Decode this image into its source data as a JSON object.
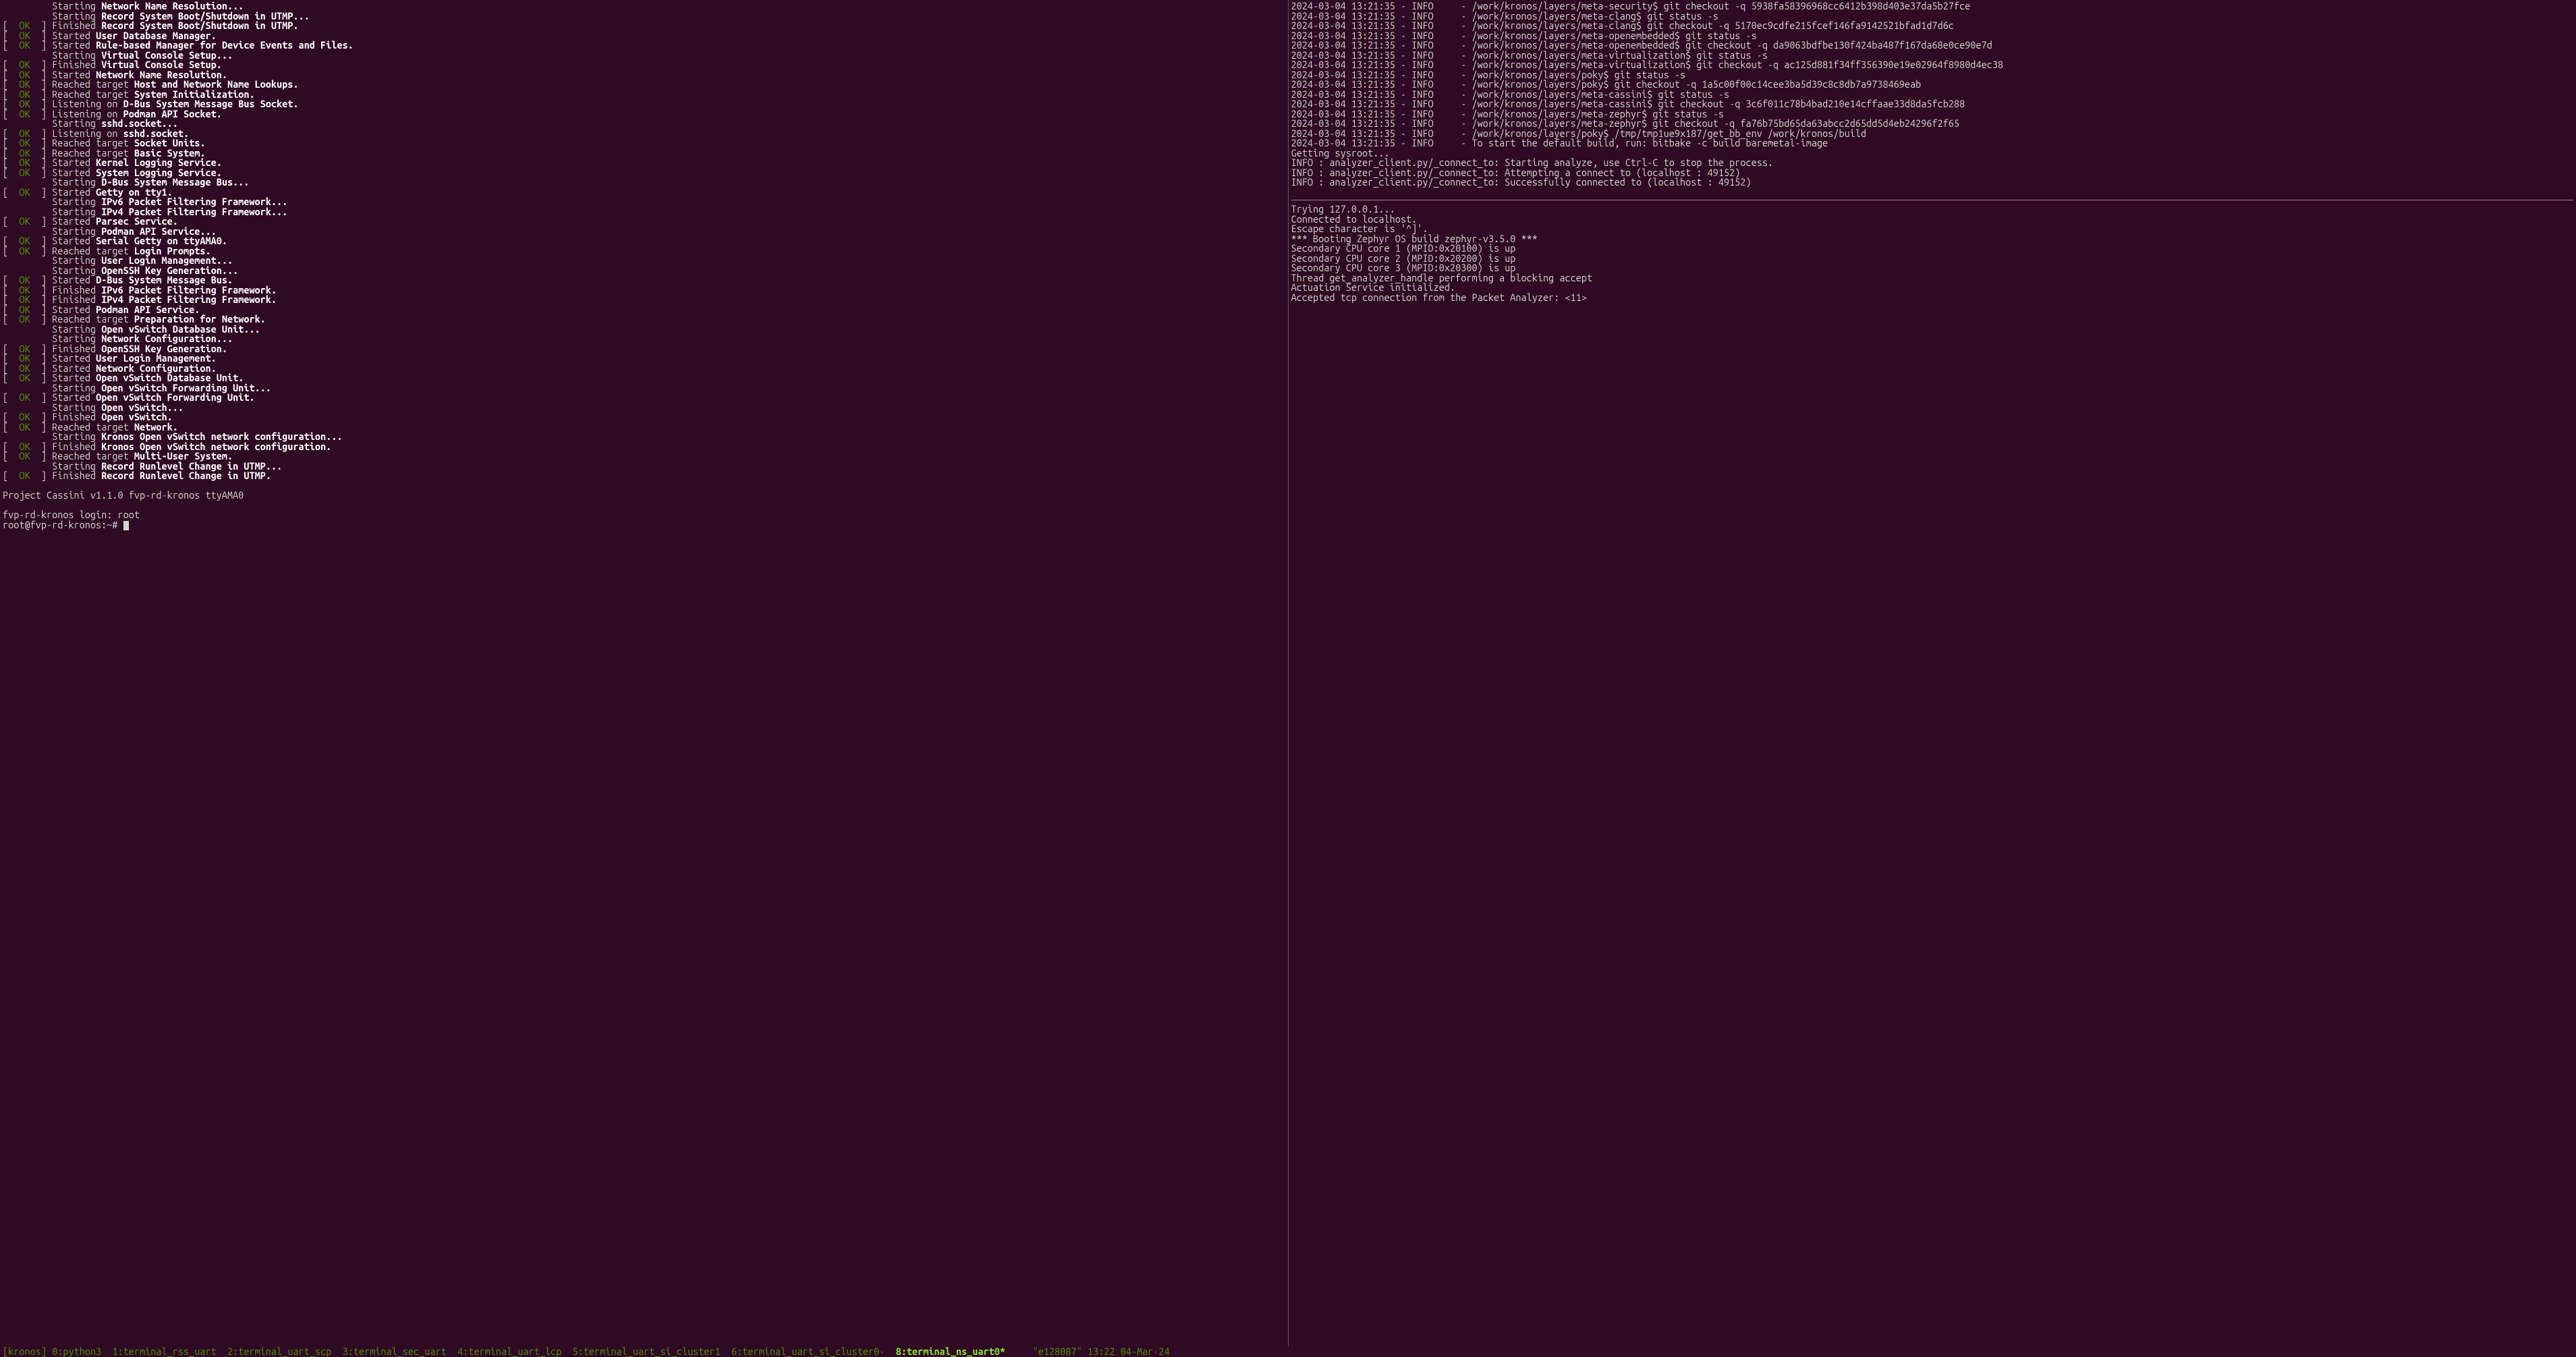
{
  "left": {
    "lines": [
      {
        "kind": "action",
        "verb": "Starting",
        "msg": "Network Name Resolution..."
      },
      {
        "kind": "action",
        "verb": "Starting",
        "msg": "Record System Boot/Shutdown in UTMP..."
      },
      {
        "kind": "ok",
        "verb": "Finished",
        "msg": "Record System Boot/Shutdown in UTMP."
      },
      {
        "kind": "ok",
        "verb": "Started",
        "msg": "User Database Manager."
      },
      {
        "kind": "ok",
        "verb": "Started",
        "msg": "Rule-based Manager for Device Events and Files."
      },
      {
        "kind": "action",
        "verb": "Starting",
        "msg": "Virtual Console Setup..."
      },
      {
        "kind": "ok",
        "verb": "Finished",
        "msg": "Virtual Console Setup."
      },
      {
        "kind": "ok",
        "verb": "Started",
        "msg": "Network Name Resolution."
      },
      {
        "kind": "ok",
        "verb": "Reached target",
        "msg": "Host and Network Name Lookups."
      },
      {
        "kind": "ok",
        "verb": "Reached target",
        "msg": "System Initialization."
      },
      {
        "kind": "ok",
        "verb": "Listening on",
        "msg": "D-Bus System Message Bus Socket."
      },
      {
        "kind": "ok",
        "verb": "Listening on",
        "msg": "Podman API Socket."
      },
      {
        "kind": "action",
        "verb": "Starting",
        "msg": "sshd.socket..."
      },
      {
        "kind": "ok",
        "verb": "Listening on",
        "msg": "sshd.socket."
      },
      {
        "kind": "ok",
        "verb": "Reached target",
        "msg": "Socket Units."
      },
      {
        "kind": "ok",
        "verb": "Reached target",
        "msg": "Basic System."
      },
      {
        "kind": "ok",
        "verb": "Started",
        "msg": "Kernel Logging Service."
      },
      {
        "kind": "ok",
        "verb": "Started",
        "msg": "System Logging Service."
      },
      {
        "kind": "action",
        "verb": "Starting",
        "msg": "D-Bus System Message Bus..."
      },
      {
        "kind": "ok",
        "verb": "Started",
        "msg": "Getty on tty1."
      },
      {
        "kind": "action",
        "verb": "Starting",
        "msg": "IPv6 Packet Filtering Framework..."
      },
      {
        "kind": "action",
        "verb": "Starting",
        "msg": "IPv4 Packet Filtering Framework..."
      },
      {
        "kind": "ok",
        "verb": "Started",
        "msg": "Parsec Service."
      },
      {
        "kind": "action",
        "verb": "Starting",
        "msg": "Podman API Service..."
      },
      {
        "kind": "ok",
        "verb": "Started",
        "msg": "Serial Getty on ttyAMA0."
      },
      {
        "kind": "ok",
        "verb": "Reached target",
        "msg": "Login Prompts."
      },
      {
        "kind": "action",
        "verb": "Starting",
        "msg": "User Login Management..."
      },
      {
        "kind": "action",
        "verb": "Starting",
        "msg": "OpenSSH Key Generation..."
      },
      {
        "kind": "ok",
        "verb": "Started",
        "msg": "D-Bus System Message Bus."
      },
      {
        "kind": "ok",
        "verb": "Finished",
        "msg": "IPv6 Packet Filtering Framework."
      },
      {
        "kind": "ok",
        "verb": "Finished",
        "msg": "IPv4 Packet Filtering Framework."
      },
      {
        "kind": "ok",
        "verb": "Started",
        "msg": "Podman API Service."
      },
      {
        "kind": "ok",
        "verb": "Reached target",
        "msg": "Preparation for Network."
      },
      {
        "kind": "action",
        "verb": "Starting",
        "msg": "Open vSwitch Database Unit..."
      },
      {
        "kind": "action",
        "verb": "Starting",
        "msg": "Network Configuration..."
      },
      {
        "kind": "ok",
        "verb": "Finished",
        "msg": "OpenSSH Key Generation."
      },
      {
        "kind": "ok",
        "verb": "Started",
        "msg": "User Login Management."
      },
      {
        "kind": "ok",
        "verb": "Started",
        "msg": "Network Configuration."
      },
      {
        "kind": "ok",
        "verb": "Started",
        "msg": "Open vSwitch Database Unit."
      },
      {
        "kind": "action",
        "verb": "Starting",
        "msg": "Open vSwitch Forwarding Unit..."
      },
      {
        "kind": "ok",
        "verb": "Started",
        "msg": "Open vSwitch Forwarding Unit."
      },
      {
        "kind": "action",
        "verb": "Starting",
        "msg": "Open vSwitch..."
      },
      {
        "kind": "ok",
        "verb": "Finished",
        "msg": "Open vSwitch."
      },
      {
        "kind": "ok",
        "verb": "Reached target",
        "msg": "Network."
      },
      {
        "kind": "action",
        "verb": "Starting",
        "msg": "Kronos Open vSwitch network configuration..."
      },
      {
        "kind": "ok",
        "verb": "Finished",
        "msg": "Kronos Open vSwitch network configuration."
      },
      {
        "kind": "ok",
        "verb": "Reached target",
        "msg": "Multi-User System."
      },
      {
        "kind": "action",
        "verb": "Starting",
        "msg": "Record Runlevel Change in UTMP..."
      },
      {
        "kind": "ok",
        "verb": "Finished",
        "msg": "Record Runlevel Change in UTMP."
      }
    ],
    "blank1": "",
    "banner": "Project Cassini v1.1.0 fvp-rd-kronos ttyAMA0",
    "blank2": "",
    "login": "fvp-rd-kronos login: root",
    "prompt": "root@fvp-rd-kronos:~# "
  },
  "right": {
    "log_lines": [
      "2024-03-04 13:21:35 - INFO     - /work/kronos/layers/meta-security$ git checkout -q 5938fa58396968cc6412b398d403e37da5b27fce",
      "2024-03-04 13:21:35 - INFO     - /work/kronos/layers/meta-clang$ git status -s",
      "2024-03-04 13:21:35 - INFO     - /work/kronos/layers/meta-clang$ git checkout -q 5170ec9cdfe215fcef146fa9142521bfad1d7d6c",
      "2024-03-04 13:21:35 - INFO     - /work/kronos/layers/meta-openembedded$ git status -s",
      "2024-03-04 13:21:35 - INFO     - /work/kronos/layers/meta-openembedded$ git checkout -q da9063bdfbe130f424ba487f167da68e0ce90e7d",
      "2024-03-04 13:21:35 - INFO     - /work/kronos/layers/meta-virtualization$ git status -s",
      "2024-03-04 13:21:35 - INFO     - /work/kronos/layers/meta-virtualization$ git checkout -q ac125d881f34ff356390e19e02964f8980d4ec38",
      "2024-03-04 13:21:35 - INFO     - /work/kronos/layers/poky$ git status -s",
      "2024-03-04 13:21:35 - INFO     - /work/kronos/layers/poky$ git checkout -q 1a5c00f00c14cee3ba5d39c8c8db7a9738469eab",
      "2024-03-04 13:21:35 - INFO     - /work/kronos/layers/meta-cassini$ git status -s",
      "2024-03-04 13:21:35 - INFO     - /work/kronos/layers/meta-cassini$ git checkout -q 3c6f011c78b4bad210e14cffaae33d8da5fcb288",
      "2024-03-04 13:21:35 - INFO     - /work/kronos/layers/meta-zephyr$ git status -s",
      "2024-03-04 13:21:35 - INFO     - /work/kronos/layers/meta-zephyr$ git checkout -q fa76b75bd65da63abcc2d65dd5d4eb24296f2f65",
      "2024-03-04 13:21:35 - INFO     - /work/kronos/layers/poky$ /tmp/tmp1ue9x187/get_bb_env /work/kronos/build",
      "2024-03-04 13:21:35 - INFO     - To start the default build, run: bitbake -c build baremetal-image",
      "Getting sysroot...",
      "INFO : analyzer_client.py/_connect_to: Starting analyze, use Ctrl-C to stop the process.",
      "INFO : analyzer_client.py/_connect_to: Attempting a connect to (localhost : 49152)",
      "INFO : analyzer_client.py/_connect_to: Successfully connected to (localhost : 49152)"
    ],
    "below_lines": [
      "Trying 127.0.0.1...",
      "Connected to localhost.",
      "Escape character is '^]'.",
      "*** Booting Zephyr OS build zephyr-v3.5.0 ***",
      "Secondary CPU core 1 (MPID:0x20100) is up",
      "Secondary CPU core 2 (MPID:0x20200) is up",
      "Secondary CPU core 3 (MPID:0x20300) is up",
      "Thread get_analyzer_handle performing a blocking accept",
      "Actuation Service initialized.",
      "Accepted tcp connection from the Packet Analyzer: <11>"
    ]
  },
  "status": {
    "session": "[kronos]",
    "windows": [
      {
        "idx": "0",
        "name": "python3",
        "sep": ":"
      },
      {
        "idx": "1",
        "name": "terminal_rss_uart",
        "sep": ":"
      },
      {
        "idx": "2",
        "name": "terminal_uart_scp",
        "sep": ":"
      },
      {
        "idx": "3",
        "name": "terminal_sec_uart",
        "sep": ":"
      },
      {
        "idx": "4",
        "name": "terminal_uart_lcp",
        "sep": ":"
      },
      {
        "idx": "5",
        "name": "terminal_uart_si_cluster1",
        "sep": ":"
      },
      {
        "idx": "6",
        "name": "terminal_uart_si_cluster0-",
        "sep": ":"
      },
      {
        "idx": "8",
        "name": "terminal_ns_uart0*",
        "sep": ":",
        "active": true
      }
    ],
    "host": "\"e128087\"",
    "clock": "13:22 04-Mar-24"
  }
}
